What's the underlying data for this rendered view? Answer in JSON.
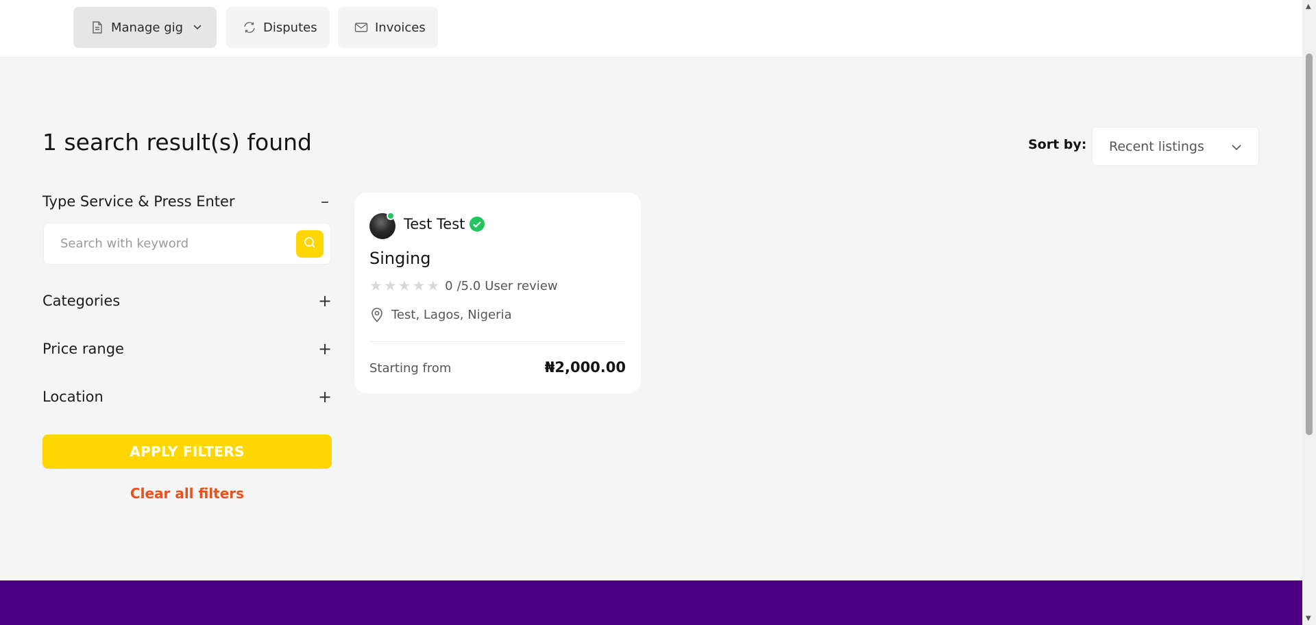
{
  "nav": {
    "tabs": [
      {
        "label": "Manage gig",
        "icon": "document-icon",
        "has_dropdown": true,
        "active": true
      },
      {
        "label": "Disputes",
        "icon": "refresh-icon"
      },
      {
        "label": "Invoices",
        "icon": "envelope-icon"
      }
    ]
  },
  "results": {
    "title": "1 search result(s) found"
  },
  "sort": {
    "label": "Sort by:",
    "selected": "Recent listings"
  },
  "filters": {
    "search_title": "Type Service & Press Enter",
    "search_placeholder": "Search with keyword",
    "categories_label": "Categories",
    "price_label": "Price range",
    "location_label": "Location",
    "apply_label": "APPLY FILTERS",
    "clear_label": "Clear all filters",
    "collapse_symbol": "–",
    "expand_symbol": "+"
  },
  "listing": {
    "seller": "Test Test",
    "title": "Singing",
    "rating_value": "0",
    "rating_max": "/5.0",
    "rating_label": "User review",
    "stars_filled": 0,
    "stars_total": 5,
    "location": "Test, Lagos, Nigeria",
    "price_label": "Starting from",
    "price": "₦2,000.00"
  },
  "colors": {
    "accent": "#ffd600",
    "clear": "#e8511c",
    "footer": "#4b0082",
    "verified": "#22c55e"
  }
}
